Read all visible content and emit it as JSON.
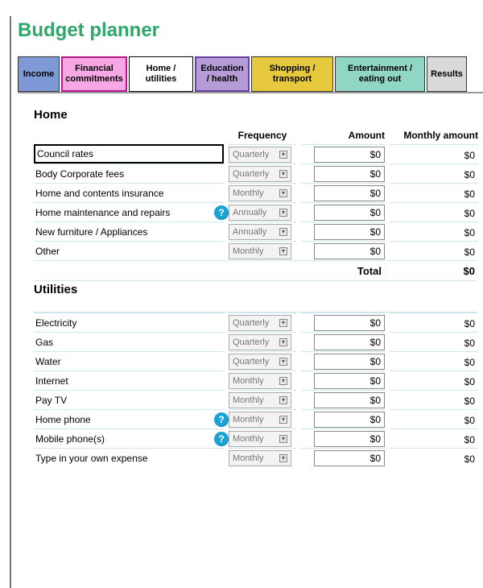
{
  "title": "Budget planner",
  "tabs": {
    "income": "Income",
    "financial": "Financial commitments",
    "home_util": "Home / utilities",
    "education": "Education / health",
    "shopping": "Shopping / transport",
    "entertainment": "Entertainment / eating out",
    "results": "Results"
  },
  "column_headers": {
    "frequency": "Frequency",
    "amount": "Amount",
    "monthly_amount": "Monthly amount"
  },
  "sections": {
    "home": {
      "title": "Home",
      "rows": [
        {
          "label": "Council rates",
          "frequency": "Quarterly",
          "amount": "$0",
          "monthly": "$0",
          "help": false,
          "boxed": true
        },
        {
          "label": "Body Corporate fees",
          "frequency": "Quarterly",
          "amount": "$0",
          "monthly": "$0",
          "help": false
        },
        {
          "label": "Home and contents insurance",
          "frequency": "Monthly",
          "amount": "$0",
          "monthly": "$0",
          "help": false
        },
        {
          "label": "Home maintenance and repairs",
          "frequency": "Annually",
          "amount": "$0",
          "monthly": "$0",
          "help": true
        },
        {
          "label": "New furniture / Appliances",
          "frequency": "Annually",
          "amount": "$0",
          "monthly": "$0",
          "help": false
        },
        {
          "label": "Other",
          "frequency": "Monthly",
          "amount": "$0",
          "monthly": "$0",
          "help": false
        }
      ],
      "total_label": "Total",
      "total_value": "$0"
    },
    "utilities": {
      "title": "Utilities",
      "rows": [
        {
          "label": "Electricity",
          "frequency": "Quarterly",
          "amount": "$0",
          "monthly": "$0",
          "help": false
        },
        {
          "label": "Gas",
          "frequency": "Quarterly",
          "amount": "$0",
          "monthly": "$0",
          "help": false
        },
        {
          "label": "Water",
          "frequency": "Quarterly",
          "amount": "$0",
          "monthly": "$0",
          "help": false
        },
        {
          "label": "Internet",
          "frequency": "Monthly",
          "amount": "$0",
          "monthly": "$0",
          "help": false
        },
        {
          "label": "Pay TV",
          "frequency": "Monthly",
          "amount": "$0",
          "monthly": "$0",
          "help": false
        },
        {
          "label": "Home phone",
          "frequency": "Monthly",
          "amount": "$0",
          "monthly": "$0",
          "help": true
        },
        {
          "label": "Mobile phone(s)",
          "frequency": "Monthly",
          "amount": "$0",
          "monthly": "$0",
          "help": true
        },
        {
          "label": "Type in your own expense",
          "frequency": "Monthly",
          "amount": "$0",
          "monthly": "$0",
          "help": false
        }
      ]
    }
  }
}
